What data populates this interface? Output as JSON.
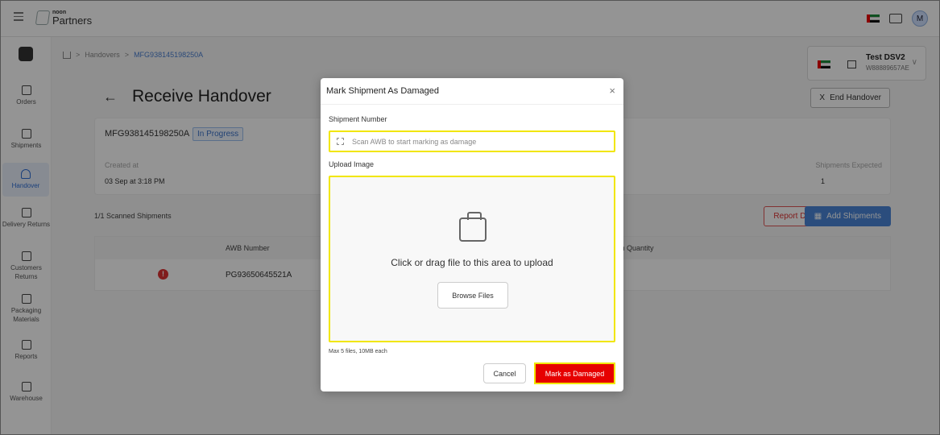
{
  "header": {
    "logo_small": "noon",
    "logo_big": "Partners",
    "avatar_initial": "M"
  },
  "sidebar": {
    "items": [
      {
        "label": "Orders",
        "icon": "orders-icon"
      },
      {
        "label": "Shipments",
        "icon": "truck-icon"
      },
      {
        "label": "Handover",
        "icon": "handover-icon",
        "active": true
      },
      {
        "label": "Delivery Returns",
        "icon": "delivery-returns-icon"
      },
      {
        "label": "Customers Returns",
        "icon": "customer-returns-icon"
      },
      {
        "label": "Packaging Materials",
        "icon": "package-icon"
      },
      {
        "label": "Reports",
        "icon": "clipboard-icon"
      },
      {
        "label": "Warehouse",
        "icon": "warehouse-icon"
      }
    ]
  },
  "breadcrumb": {
    "items": [
      "Handovers",
      "MFG938145198250A"
    ],
    "separator": ">"
  },
  "store": {
    "name": "Test DSV2",
    "code": "W88889657AE"
  },
  "page": {
    "title": "Receive Handover",
    "back_arrow": "←",
    "end_handover": "End Handover",
    "end_icon": "X"
  },
  "handover": {
    "id": "MFG938145198250A",
    "status": "In Progress",
    "created_label": "Created at",
    "created_value": "03 Sep at 3:18 PM",
    "expected_label": "Shipments Expected",
    "expected_value": "1"
  },
  "actions": {
    "scanned": "1/1 Scanned Shipments",
    "report_damages": "Report Damages",
    "add_shipments": "Add Shipments"
  },
  "table": {
    "columns": [
      "AWB Number",
      "Item Quantity"
    ],
    "rows": [
      {
        "awb": "PG93650645521A",
        "alert": "!"
      }
    ]
  },
  "modal": {
    "title": "Mark Shipment As Damaged",
    "close": "×",
    "shipment_label": "Shipment Number",
    "scan_placeholder": "Scan AWB to start marking as damage",
    "upload_label": "Upload Image",
    "drag_text": "Click or drag file to this area to upload",
    "browse": "Browse Files",
    "hint": "Max 5 files, 10MB each",
    "cancel": "Cancel",
    "submit": "Mark as Damaged"
  },
  "colors": {
    "accent": "#4a86d8",
    "danger": "#e60000",
    "highlight": "#f1e600"
  }
}
